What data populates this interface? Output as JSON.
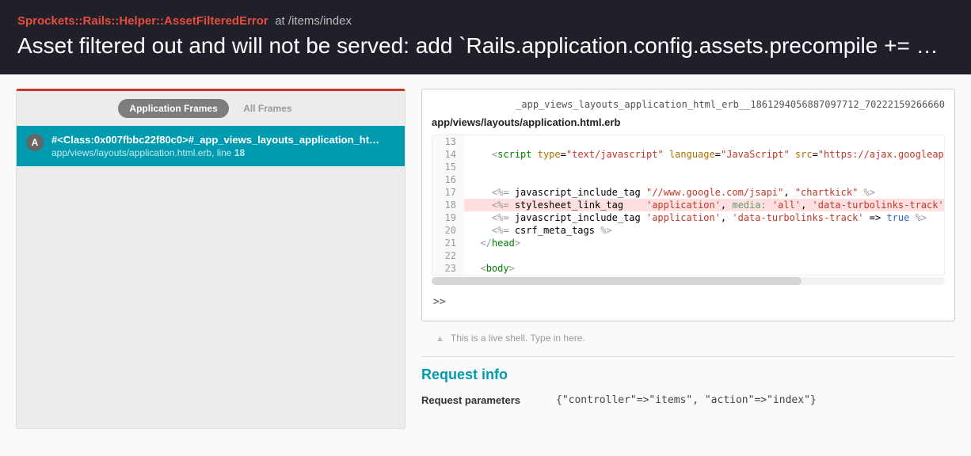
{
  "header": {
    "error_class": "Sprockets::Rails::Helper::AssetFilteredError",
    "at_label": "at",
    "path": "/items/index",
    "title": "Asset filtered out and will not be served: add `Rails.application.config.assets.precompile += %w( glyphi…"
  },
  "tabs": {
    "app_frames": "Application Frames",
    "all_frames": "All Frames"
  },
  "frame": {
    "badge": "A",
    "method": "#<Class:0x007fbbc22f80c0>#_app_views_layouts_application_ht…",
    "location_prefix": "app/views/layouts/application.html.erb, line ",
    "line_number": "18"
  },
  "code": {
    "frame_id": "_app_views_layouts_application_html_erb__1861294056887097712_70222159266660",
    "file": "app/views/layouts/application.html.erb",
    "prompt": ">>",
    "hint": "This is a live shell. Type in here.",
    "lines": [
      {
        "n": "13",
        "html": ""
      },
      {
        "n": "14",
        "html": "    <span class='tok-sym'>&lt;</span><span class='tok-tag'>script</span> <span class='tok-attr'>type</span>=<span class='tok-str'>\"text/javascript\"</span> <span class='tok-attr'>language</span>=<span class='tok-str'>\"JavaScript\"</span> <span class='tok-attr'>src</span>=<span class='tok-str'>\"https://ajax.googleapis.com/ajax/libs</span>"
      },
      {
        "n": "15",
        "html": ""
      },
      {
        "n": "16",
        "html": ""
      },
      {
        "n": "17",
        "html": "    <span class='tok-sym'>&lt;%=</span> javascript_include_tag <span class='tok-str'>\"//www.google.com/jsapi\"</span>, <span class='tok-str'>\"chartkick\"</span> <span class='tok-sym'>%&gt;</span>"
      },
      {
        "n": "18",
        "hl": true,
        "html": "    <span class='tok-sym'>&lt;%=</span> stylesheet_link_tag    <span class='tok-str'>'application'</span>, <span class='tok-key'>media:</span> <span class='tok-str'>'all'</span>, <span class='tok-str'>'data-turbolinks-track'</span> =&gt; <span class='tok-true'>true</span> <span class='tok-sym'>%&gt;</span>"
      },
      {
        "n": "19",
        "html": "    <span class='tok-sym'>&lt;%=</span> javascript_include_tag <span class='tok-str'>'application'</span>, <span class='tok-str'>'data-turbolinks-track'</span> =&gt; <span class='tok-true'>true</span> <span class='tok-sym'>%&gt;</span>"
      },
      {
        "n": "20",
        "html": "    <span class='tok-sym'>&lt;%=</span> csrf_meta_tags <span class='tok-sym'>%&gt;</span>"
      },
      {
        "n": "21",
        "html": "  <span class='tok-sym'>&lt;/</span><span class='tok-tag'>head</span><span class='tok-sym'>&gt;</span>"
      },
      {
        "n": "22",
        "html": ""
      },
      {
        "n": "23",
        "html": "  <span class='tok-sym'>&lt;</span><span class='tok-tag'>body</span><span class='tok-sym'>&gt;</span>"
      }
    ]
  },
  "request_info": {
    "title": "Request info",
    "params_label": "Request parameters",
    "params_value": "{\"controller\"=>\"items\", \"action\"=>\"index\"}"
  }
}
